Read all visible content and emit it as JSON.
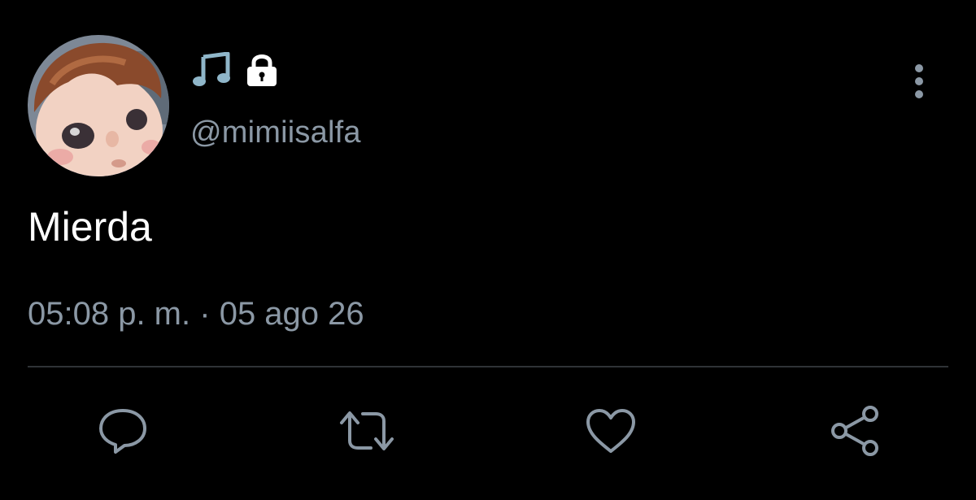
{
  "user": {
    "handle": "@mimiisalfa",
    "display_icons": [
      "music-note-icon",
      "lock-icon"
    ],
    "avatar": "profile-avatar"
  },
  "tweet": {
    "text": "Mierda",
    "time": "05:08 p. m.",
    "separator": "·",
    "date": "05 ago 26"
  },
  "actions": [
    "reply-icon",
    "retweet-icon",
    "like-icon",
    "share-icon"
  ],
  "colors": {
    "background": "#000000",
    "text": "#ffffff",
    "muted": "#8b98a5",
    "divider": "#2f3336"
  }
}
